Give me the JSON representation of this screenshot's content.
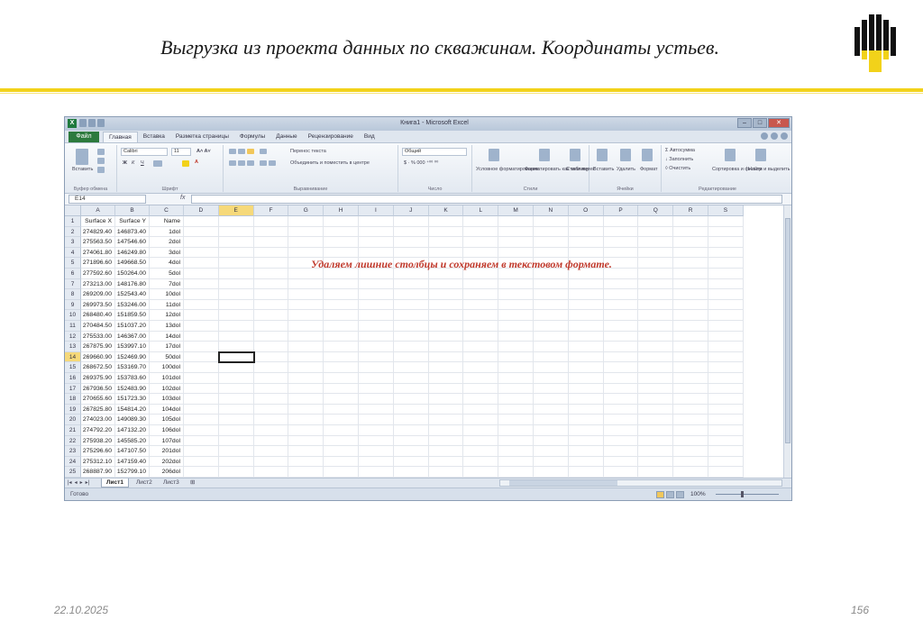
{
  "slide": {
    "title": "Выгрузка из проекта данных по скважинам. Координаты устьев.",
    "date": "22.10.2025",
    "page_number": "156",
    "accent_color": "#f2d21a"
  },
  "excel": {
    "window_title": "Книга1 - Microsoft Excel",
    "tabs": [
      "Файл",
      "Главная",
      "Вставка",
      "Разметка страницы",
      "Формулы",
      "Данные",
      "Рецензирование",
      "Вид"
    ],
    "ribbon": {
      "paste": "Вставить",
      "font_name": "Calibri",
      "font_size": "11",
      "wrap_text": "Перенос текста",
      "merge": "Объединить и поместить в центре",
      "number_format": "Общий",
      "cond_format": "Условное форматирование",
      "format_table": "Форматировать как таблицу",
      "cell_styles": "Стили ячеек",
      "insert": "Вставить",
      "delete": "Удалить",
      "format": "Формат",
      "autosum": "Автосумма",
      "fill": "Заполнить",
      "clear": "Очистить",
      "sort": "Сортировка и фильтр",
      "find": "Найти и выделить",
      "groups": [
        "Буфер обмена",
        "Шрифт",
        "Выравнивание",
        "Число",
        "Стили",
        "Ячейки",
        "Редактирование"
      ]
    },
    "name_box": "E14",
    "fx_label": "fx",
    "columns": [
      "A",
      "B",
      "C",
      "D",
      "E",
      "F",
      "G",
      "H",
      "I",
      "J",
      "K",
      "L",
      "M",
      "N",
      "O",
      "P",
      "Q",
      "R",
      "S"
    ],
    "selected_column": "E",
    "selected_row": "14",
    "rows": [
      {
        "n": "1",
        "a": "Surface X",
        "b": "Surface Y",
        "c": "Name"
      },
      {
        "n": "2",
        "a": "274829.40",
        "b": "146873.40",
        "c": "1dol"
      },
      {
        "n": "3",
        "a": "275563.50",
        "b": "147546.60",
        "c": "2dol"
      },
      {
        "n": "4",
        "a": "274061.80",
        "b": "146249.80",
        "c": "3dol"
      },
      {
        "n": "5",
        "a": "271896.60",
        "b": "149668.50",
        "c": "4dol"
      },
      {
        "n": "6",
        "a": "277592.60",
        "b": "150264.00",
        "c": "5dol"
      },
      {
        "n": "7",
        "a": "273213.00",
        "b": "148176.80",
        "c": "7dol"
      },
      {
        "n": "8",
        "a": "269209.00",
        "b": "152543.40",
        "c": "10dol"
      },
      {
        "n": "9",
        "a": "269973.50",
        "b": "153246.00",
        "c": "11dol"
      },
      {
        "n": "10",
        "a": "268480.40",
        "b": "151859.50",
        "c": "12dol"
      },
      {
        "n": "11",
        "a": "270484.50",
        "b": "151037.20",
        "c": "13dol"
      },
      {
        "n": "12",
        "a": "275533.00",
        "b": "146367.00",
        "c": "14dol"
      },
      {
        "n": "13",
        "a": "267875.90",
        "b": "153997.10",
        "c": "17dol"
      },
      {
        "n": "14",
        "a": "269660.90",
        "b": "152469.90",
        "c": "50dol"
      },
      {
        "n": "15",
        "a": "268672.50",
        "b": "153169.70",
        "c": "100dol"
      },
      {
        "n": "16",
        "a": "269375.90",
        "b": "153783.60",
        "c": "101dol"
      },
      {
        "n": "17",
        "a": "267936.50",
        "b": "152483.90",
        "c": "102dol"
      },
      {
        "n": "18",
        "a": "270655.60",
        "b": "151723.30",
        "c": "103dol"
      },
      {
        "n": "19",
        "a": "267825.80",
        "b": "154814.20",
        "c": "104dol"
      },
      {
        "n": "20",
        "a": "274023.00",
        "b": "149089.30",
        "c": "105dol"
      },
      {
        "n": "21",
        "a": "274792.20",
        "b": "147132.20",
        "c": "106dol"
      },
      {
        "n": "22",
        "a": "275938.20",
        "b": "145585.20",
        "c": "107dol"
      },
      {
        "n": "23",
        "a": "275296.60",
        "b": "147107.50",
        "c": "201dol"
      },
      {
        "n": "24",
        "a": "275312.10",
        "b": "147159.40",
        "c": "202dol"
      },
      {
        "n": "25",
        "a": "268887.90",
        "b": "152799.10",
        "c": "206dol"
      }
    ],
    "annotation": "Удаляем лишние столбцы и сохраняем в текстовом формате.",
    "sheets": [
      "Лист1",
      "Лист2",
      "Лист3"
    ],
    "status": "Готово",
    "zoom": "100%"
  }
}
